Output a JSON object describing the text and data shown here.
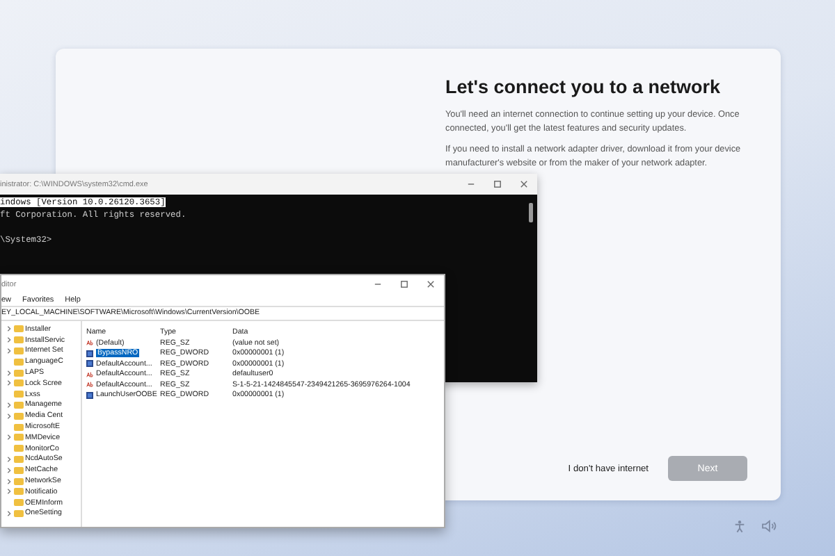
{
  "setup": {
    "title": "Let's connect you to a network",
    "paragraphs": [
      "You'll need an internet connection to continue setting up your device. Once connected, you'll get the latest features and security updates.",
      "If you need to install a network adapter driver, download it from your device manufacturer's website or from the maker of your network adapter."
    ],
    "skip_link": "I don't have internet",
    "next_button": {
      "label": "Next",
      "disabled": true
    }
  },
  "cmd": {
    "title": "inistrator: C:\\WINDOWS\\system32\\cmd.exe",
    "lines": [
      {
        "text": "indows [Version 10.0.26120.3653]",
        "selected": true
      },
      {
        "text": "ft Corporation. All rights reserved.",
        "selected": false
      },
      {
        "selected": false
      },
      {
        "text": "\\System32>",
        "selected": false
      }
    ]
  },
  "regedit": {
    "title": "ditor",
    "menu": [
      "ew",
      "Favorites",
      "Help"
    ],
    "address": "EY_LOCAL_MACHINE\\SOFTWARE\\Microsoft\\Windows\\CurrentVersion\\OOBE",
    "tree": [
      {
        "label": "Installer",
        "expandable": true
      },
      {
        "label": "InstallServic",
        "expandable": true
      },
      {
        "label": "Internet Set",
        "expandable": true
      },
      {
        "label": "LanguageC",
        "expandable": false
      },
      {
        "label": "LAPS",
        "expandable": true
      },
      {
        "label": "Lock Scree",
        "expandable": true
      },
      {
        "label": "Lxss",
        "expandable": false
      },
      {
        "label": "Manageme",
        "expandable": true
      },
      {
        "label": "Media Cent",
        "expandable": true
      },
      {
        "label": "MicrosoftE",
        "expandable": false
      },
      {
        "label": "MMDevice",
        "expandable": true
      },
      {
        "label": "MonitorCo",
        "expandable": false
      },
      {
        "label": "NcdAutoSe",
        "expandable": true
      },
      {
        "label": "NetCache",
        "expandable": true
      },
      {
        "label": "NetworkSe",
        "expandable": true
      },
      {
        "label": "Notificatio",
        "expandable": true
      },
      {
        "label": "OEMInform",
        "expandable": false
      },
      {
        "label": "OneSetting",
        "expandable": true
      }
    ],
    "columns": [
      "Name",
      "Type",
      "Data"
    ],
    "values": [
      {
        "kind": "string",
        "name": "(Default)",
        "type": "REG_SZ",
        "data": "(value not set)",
        "selected": false
      },
      {
        "kind": "number",
        "name": "BypassNRO",
        "type": "REG_DWORD",
        "data": "0x00000001 (1)",
        "selected": true
      },
      {
        "kind": "number",
        "name": "DefaultAccount...",
        "type": "REG_DWORD",
        "data": "0x00000001 (1)",
        "selected": false
      },
      {
        "kind": "string",
        "name": "DefaultAccount...",
        "type": "REG_SZ",
        "data": "defaultuser0",
        "selected": false
      },
      {
        "kind": "string",
        "name": "DefaultAccount...",
        "type": "REG_SZ",
        "data": "S-1-5-21-1424845547-2349421265-3695976264-1004",
        "selected": false
      },
      {
        "kind": "number",
        "name": "LaunchUserOOBE",
        "type": "REG_DWORD",
        "data": "0x00000001 (1)",
        "selected": false
      }
    ]
  }
}
